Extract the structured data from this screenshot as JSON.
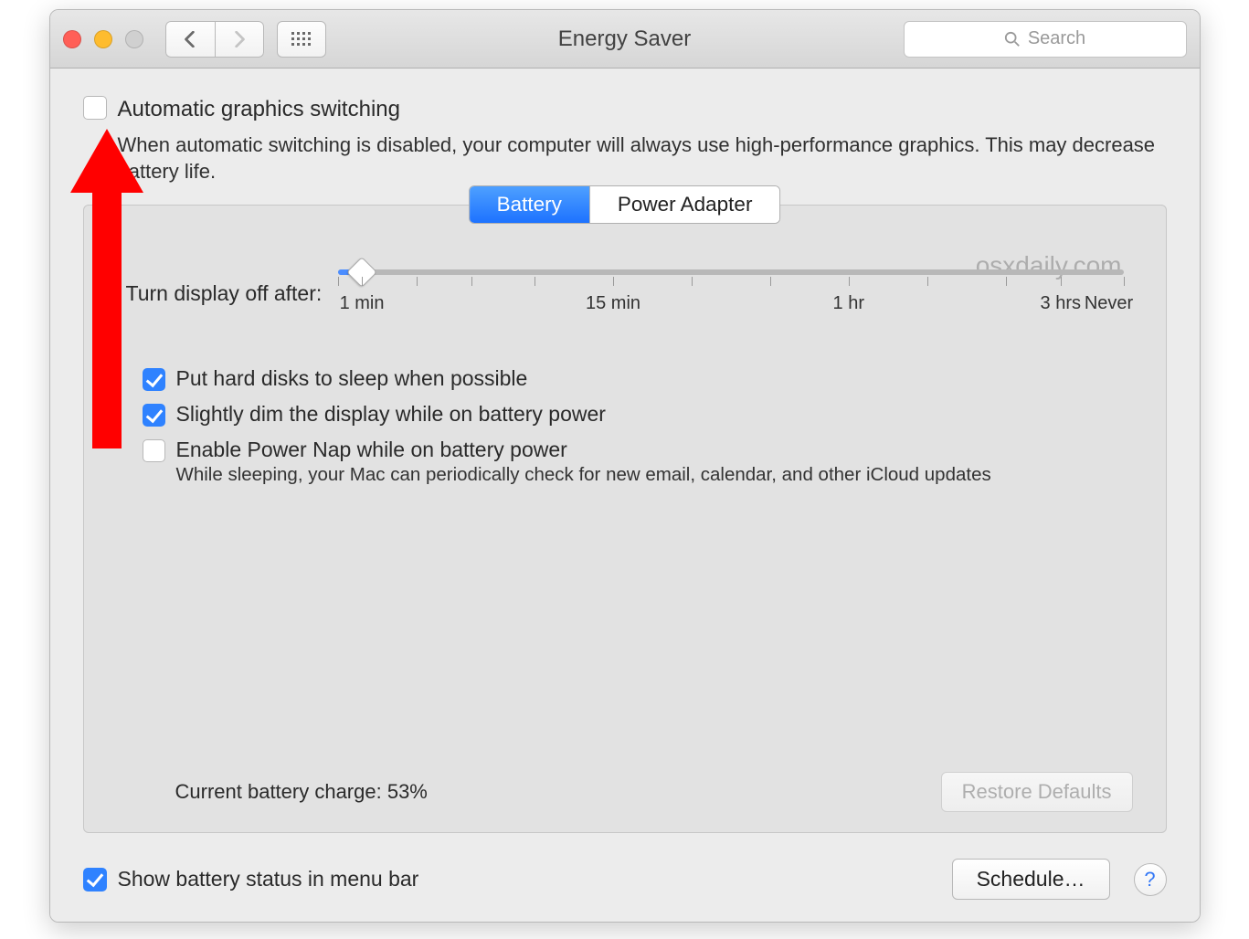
{
  "titlebar": {
    "title": "Energy Saver",
    "search_placeholder": "Search"
  },
  "auto_switch": {
    "label": "Automatic graphics switching",
    "description": "When automatic switching is disabled, your computer will always use high-performance graphics. This may decrease battery life.",
    "checked": false
  },
  "tabs": {
    "battery": "Battery",
    "power_adapter": "Power Adapter",
    "active": "battery"
  },
  "watermark": "osxdaily.com",
  "slider": {
    "label": "Turn display off after:",
    "tick_labels": {
      "min1": "1 min",
      "min15": "15 min",
      "hr1": "1 hr",
      "hr3": "3 hrs",
      "never": "Never"
    }
  },
  "options": {
    "hard_disks": {
      "label": "Put hard disks to sleep when possible",
      "checked": true
    },
    "dim_display": {
      "label": "Slightly dim the display while on battery power",
      "checked": true
    },
    "power_nap": {
      "label": "Enable Power Nap while on battery power",
      "checked": false,
      "sub": "While sleeping, your Mac can periodically check for new email, calendar, and other iCloud updates"
    }
  },
  "battery_charge": "Current battery charge: 53%",
  "restore_defaults": "Restore Defaults",
  "show_status": {
    "label": "Show battery status in menu bar",
    "checked": true
  },
  "schedule": "Schedule…",
  "help": "?"
}
